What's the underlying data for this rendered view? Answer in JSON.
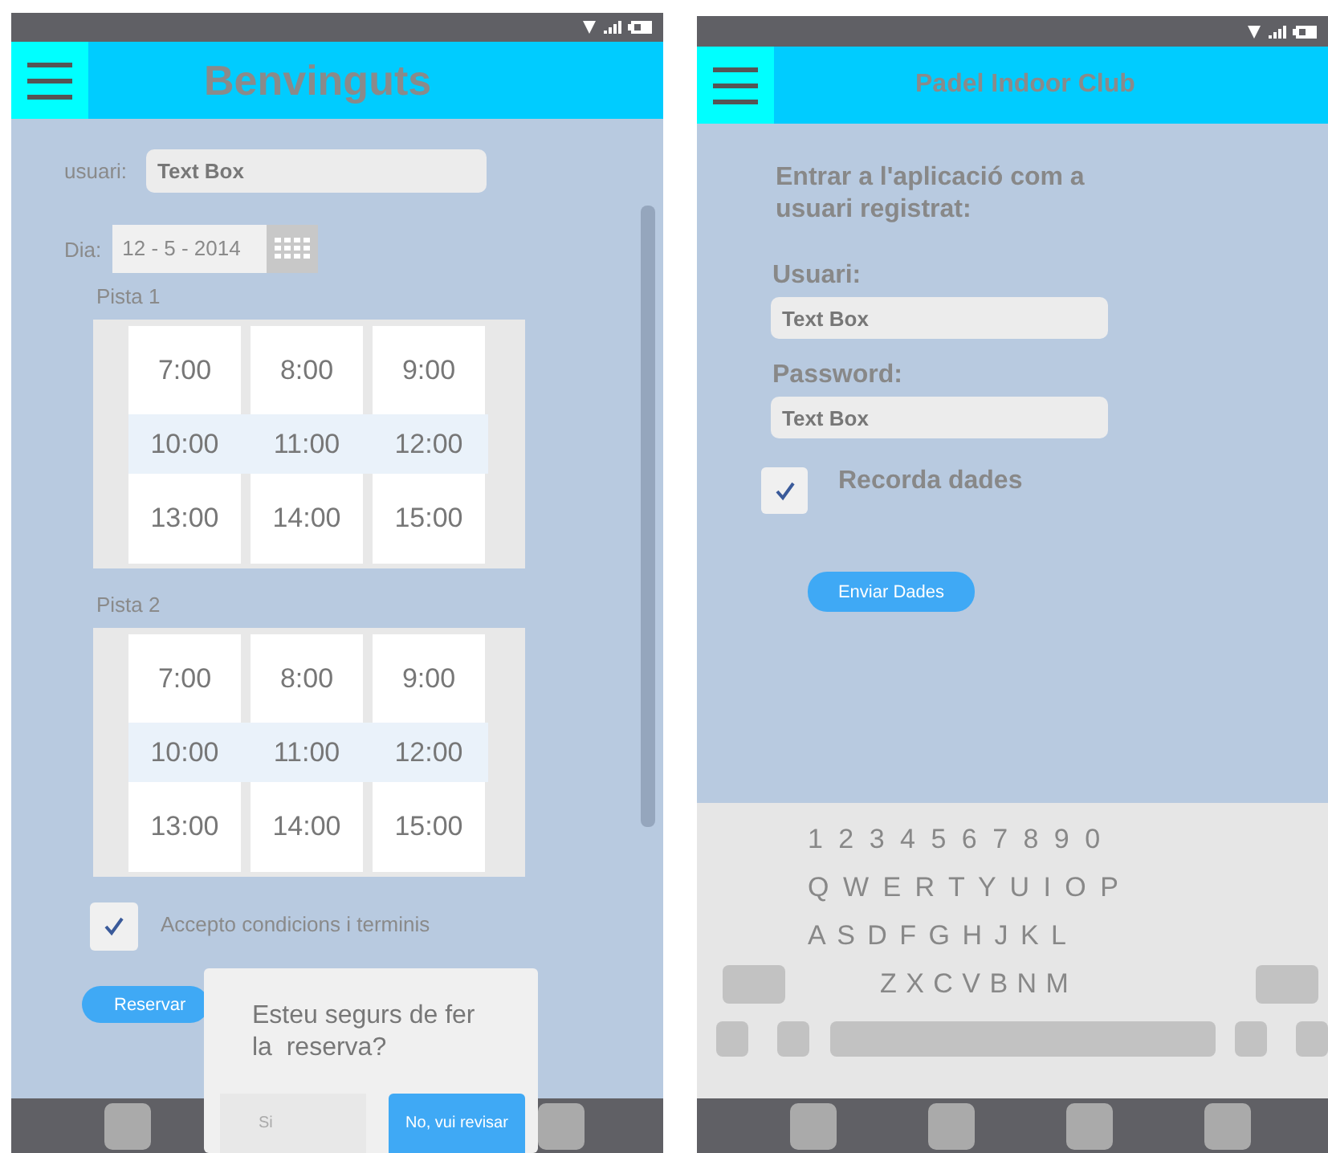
{
  "left_screen": {
    "header": {
      "title": "Benvinguts"
    },
    "user_field": {
      "label": "usuari:",
      "placeholder": "Text Box"
    },
    "date_field": {
      "label": "Dia:",
      "value": "12 - 5 - 2014"
    },
    "courts": [
      {
        "label": "Pista 1",
        "rows": [
          {
            "selected": false,
            "times": [
              "7:00",
              "8:00",
              "9:00"
            ]
          },
          {
            "selected": true,
            "times": [
              "10:00",
              "11:00",
              "12:00"
            ]
          },
          {
            "selected": false,
            "times": [
              "13:00",
              "14:00",
              "15:00"
            ]
          }
        ]
      },
      {
        "label": "Pista 2",
        "rows": [
          {
            "selected": false,
            "times": [
              "7:00",
              "8:00",
              "9:00"
            ]
          },
          {
            "selected": true,
            "times": [
              "10:00",
              "11:00",
              "12:00"
            ]
          },
          {
            "selected": false,
            "times": [
              "13:00",
              "14:00",
              "15:00"
            ]
          }
        ]
      }
    ],
    "terms": {
      "label": "Accepto condicions i terminis",
      "checked": true
    },
    "reserve_button": "Reservar",
    "dialog": {
      "message": "Esteu segurs de fer la  reserva?",
      "buttons": [
        {
          "label": "Si",
          "kind": "secondary"
        },
        {
          "label": "No, vui revisar",
          "kind": "primary"
        }
      ]
    }
  },
  "right_screen": {
    "header": {
      "title": "Padel Indoor Club"
    },
    "intro": "Entrar a l'aplicació com a usuari registrat:",
    "user_field": {
      "label": "Usuari:",
      "placeholder": "Text Box"
    },
    "password_field": {
      "label": "Password:",
      "placeholder": "Text Box"
    },
    "remember": {
      "label": "Recorda dades",
      "checked": true
    },
    "send_button": "Enviar Dades",
    "keyboard": {
      "rows": [
        "1 2 3 4 5 6 7 8 9 0",
        "Q W E R T Y U I O P",
        "A S D F G H J K L",
        "Z X C V B N M"
      ]
    }
  }
}
